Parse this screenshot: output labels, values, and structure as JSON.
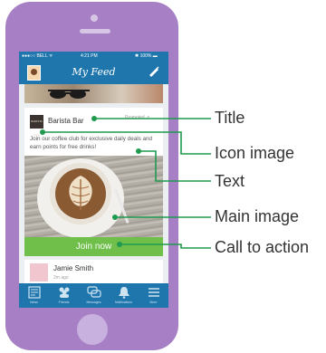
{
  "phone": {
    "status_bar": {
      "carrier": "●●●○○ BELL ᯤ",
      "time": "4:21 PM",
      "battery": "✱ 100% ▬"
    },
    "nav_bar": {
      "title": "My Feed",
      "compose_icon": "pen-icon"
    },
    "promoted_card": {
      "brand_icon_text": "BARISTA BAR",
      "brand_name": "Barista Bar",
      "promoted_label": "Promoted ↗",
      "text": "Join our coffee club for exclusive daily deals and earn points for free drinks!",
      "cta_label": "Join now"
    },
    "next_card": {
      "name": "Jamie Smith",
      "time": "2m ago"
    },
    "tab_bar": [
      {
        "label": "News",
        "icon": "news-icon"
      },
      {
        "label": "Friends",
        "icon": "friends-icon"
      },
      {
        "label": "Messages",
        "icon": "messages-icon"
      },
      {
        "label": "Notifications",
        "icon": "bell-icon"
      },
      {
        "label": "More",
        "icon": "menu-icon"
      }
    ]
  },
  "callouts": [
    {
      "label": "Title"
    },
    {
      "label": "Icon image"
    },
    {
      "label": "Text"
    },
    {
      "label": "Main image"
    },
    {
      "label": "Call to action"
    }
  ],
  "colors": {
    "phone_body": "#a67fc5",
    "app_blue": "#1e76ad",
    "cta_green": "#6fbf4a",
    "callout_green": "#1f9a4f"
  }
}
